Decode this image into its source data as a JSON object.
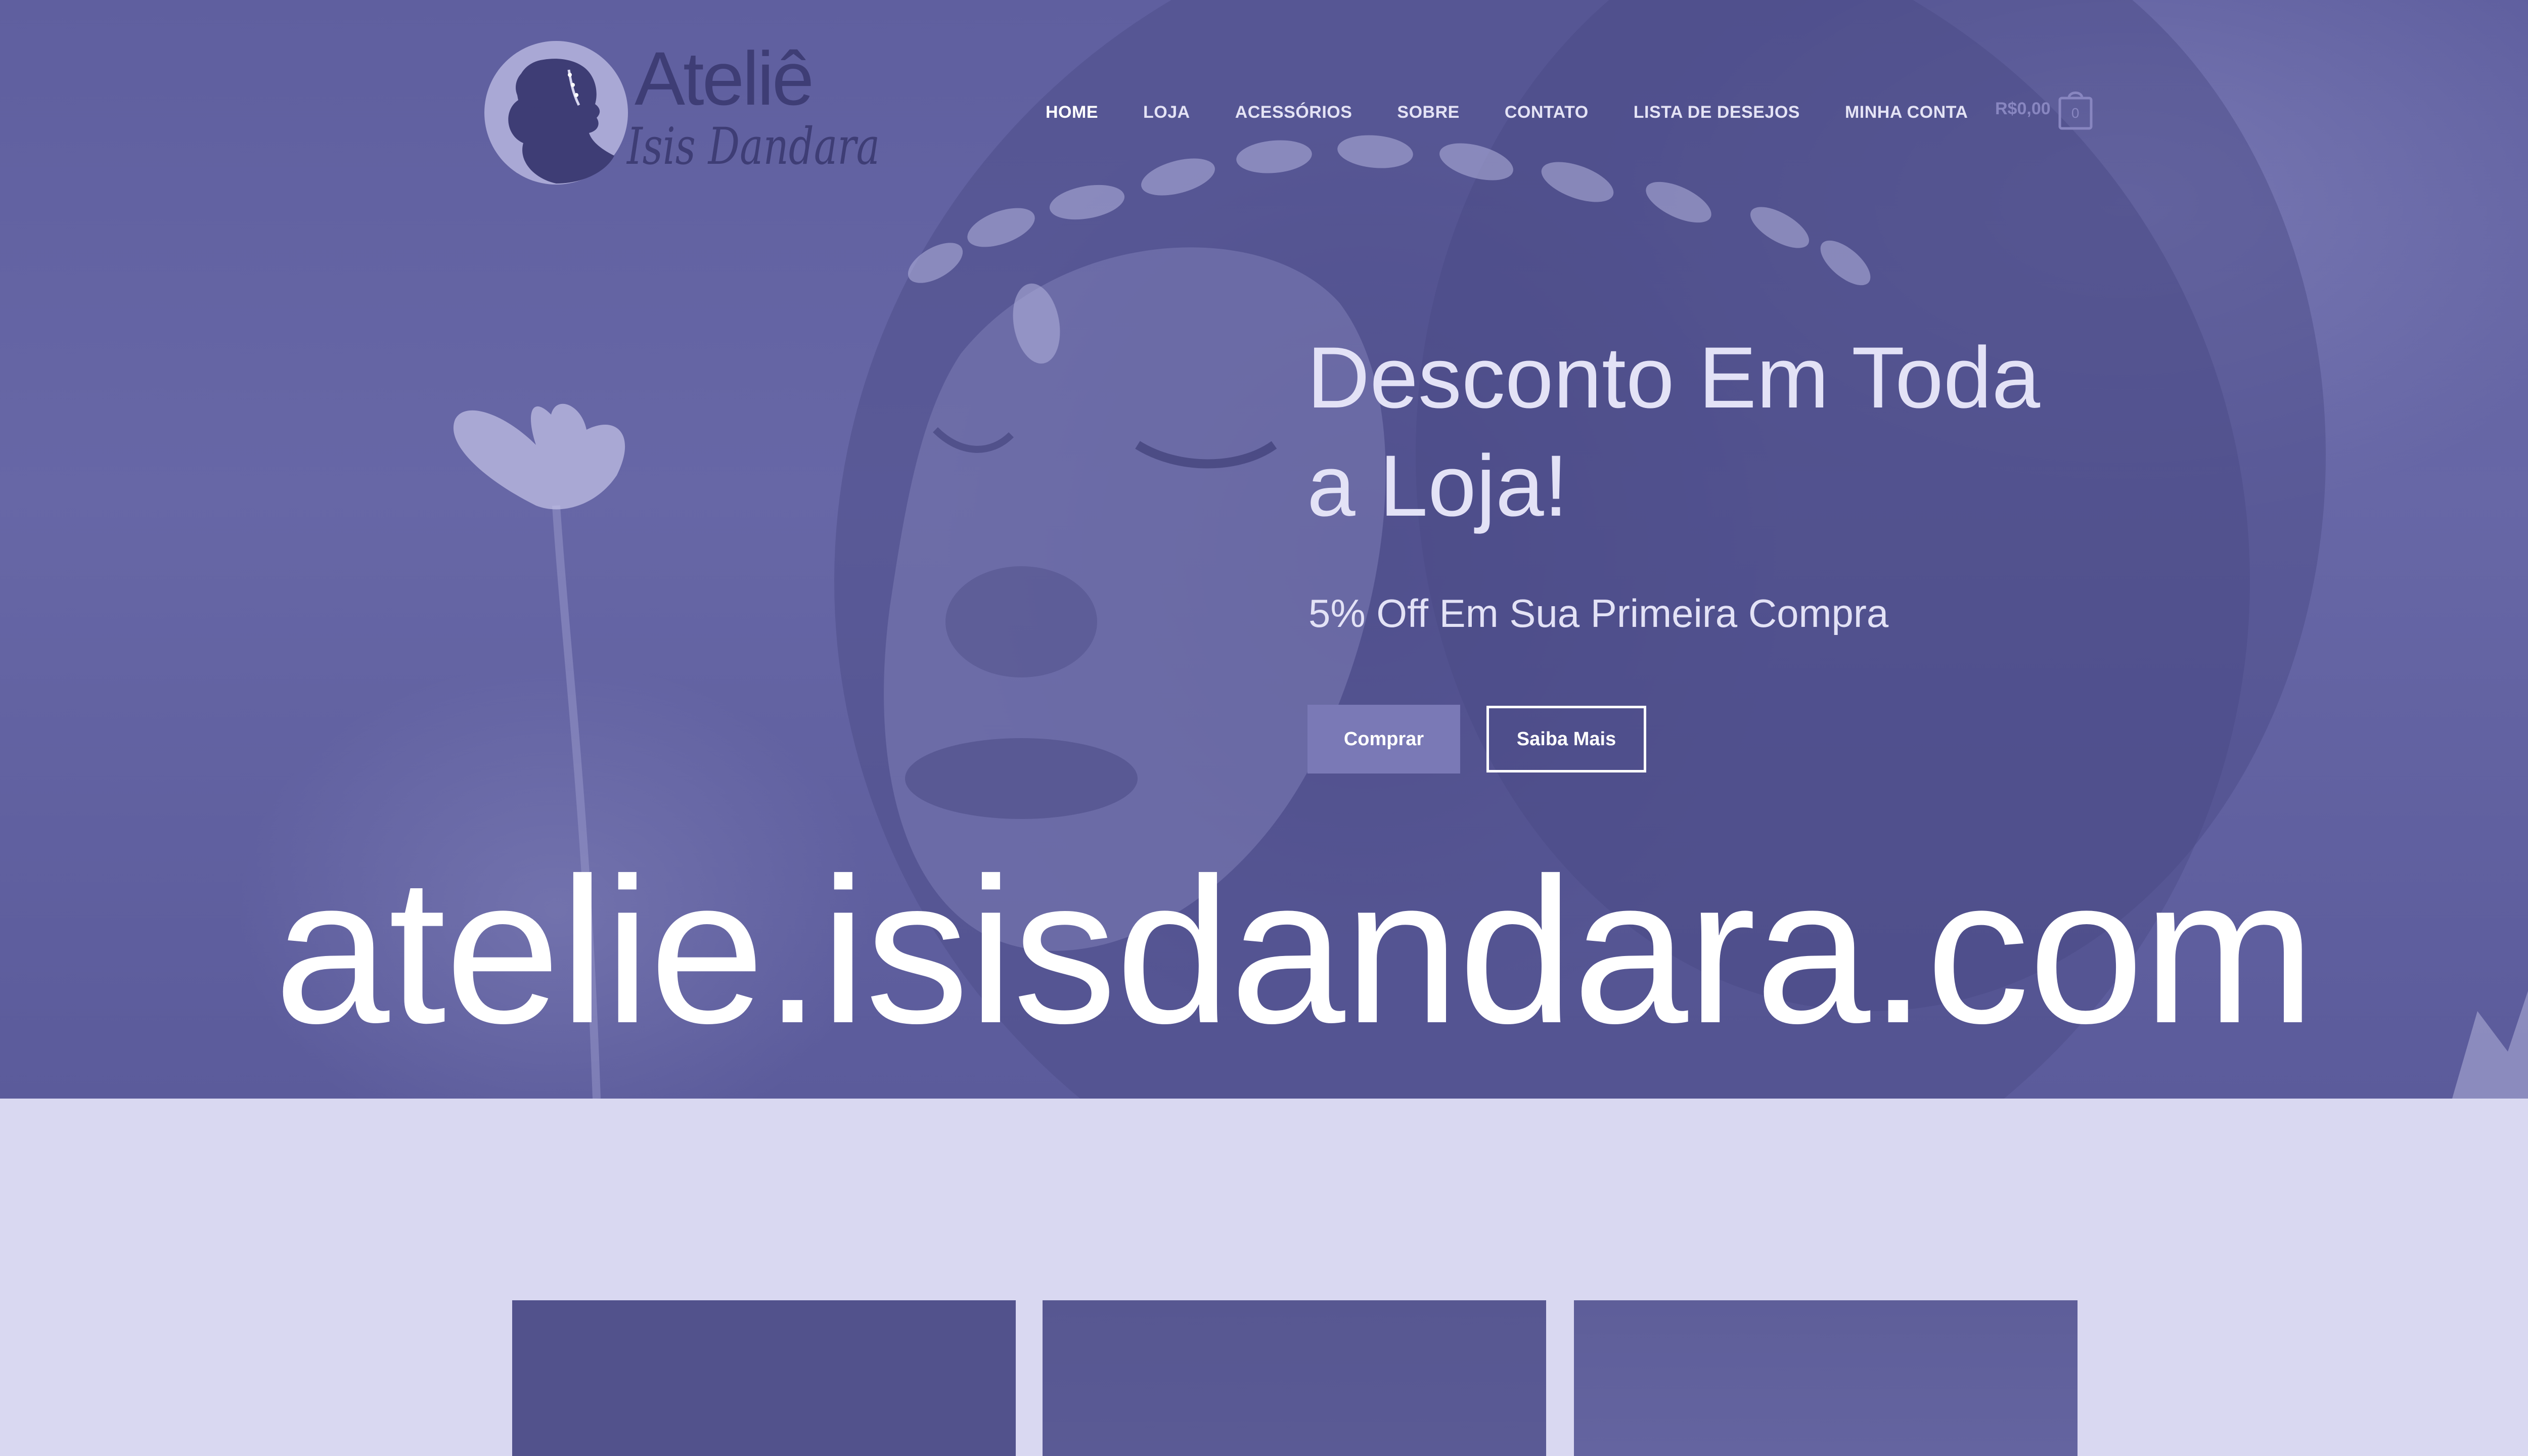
{
  "brand": {
    "logo_title": "Ateliê",
    "logo_subtitle": "Isis Dandara"
  },
  "nav": {
    "items": [
      {
        "label": "HOME",
        "active": true
      },
      {
        "label": "LOJA",
        "active": false
      },
      {
        "label": "ACESSÓRIOS",
        "active": false
      },
      {
        "label": "SOBRE",
        "active": false
      },
      {
        "label": "CONTATO",
        "active": false
      },
      {
        "label": "LISTA DE DESEJOS",
        "active": false
      },
      {
        "label": "MINHA CONTA",
        "active": false
      }
    ]
  },
  "cart": {
    "total": "R$0,00",
    "count": "0"
  },
  "hero": {
    "heading_line1": "Desconto Em Toda",
    "heading_line2": "a Loja!",
    "subheading": "5% Off Em Sua Primeira Compra",
    "primary_button": "Comprar",
    "secondary_button": "Saiba Mais"
  },
  "watermark": "atelie.isisdandara.com",
  "colors": {
    "hero_tint": "#6363a2",
    "section_background": "#d9d8f1",
    "nav_text": "#e4e3f5",
    "button_primary": "#7a79b6"
  }
}
